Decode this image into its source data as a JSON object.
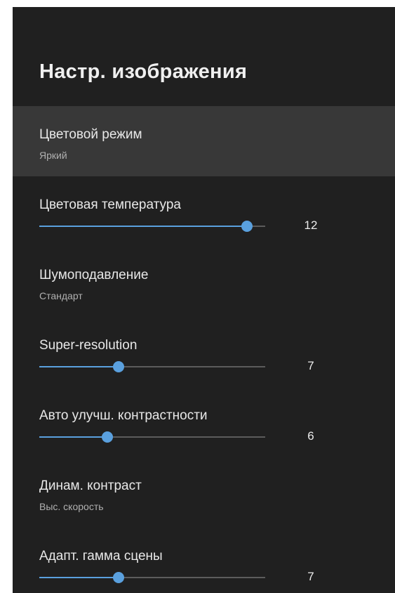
{
  "page": {
    "title": "Настр. изображения"
  },
  "colors": {
    "background": "#202020",
    "selected_row": "#383838",
    "accent": "#5aa0de",
    "track": "#5c5c5c"
  },
  "settings": [
    {
      "label": "Цветовой режим",
      "value": "Яркий",
      "selected": true
    },
    {
      "label": "Цветовая температура",
      "slider_value": "12",
      "level": 0.92
    },
    {
      "label": "Шумоподавление",
      "value": "Стандарт"
    },
    {
      "label": "Super-resolution",
      "slider_value": "7",
      "level": 0.35
    },
    {
      "label": "Авто улучш. контрастности",
      "slider_value": "6",
      "level": 0.3
    },
    {
      "label": "Динам. контраст",
      "value": "Выс. скорость"
    },
    {
      "label": "Адапт. гамма сцены",
      "slider_value": "7",
      "level": 0.35
    }
  ]
}
